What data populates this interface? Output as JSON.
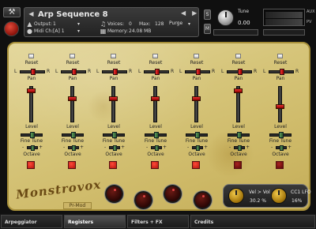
{
  "header": {
    "instrument_name": "Arp Sequence 8",
    "output_label": "Output:",
    "output_value": "1",
    "midi_label": "Midi Ch:",
    "midi_value": "[A] 1",
    "voices_label": "Voices:",
    "voices_value": "0",
    "max_label": "Max:",
    "max_value": "128",
    "purge_label": "Purge",
    "memory_label": "Memory:",
    "memory_value": "24.08 MB",
    "tune_label": "Tune",
    "tune_value": "0.00",
    "s_button": "S",
    "m_button": "M",
    "aux_label": "AUX",
    "pv_label": "PV"
  },
  "channel_labels": {
    "reset": "Reset",
    "pan": "Pan",
    "L": "L",
    "R": "R",
    "level": "Level",
    "fine_tune": "Fine Tune",
    "octave": "Octave",
    "minus": "-",
    "plus": "+"
  },
  "channels": [
    {
      "pan": 0.5,
      "level": 0.05,
      "fine_tune": 0.5,
      "octave": 0,
      "led_on": true
    },
    {
      "pan": 0.5,
      "level": 0.3,
      "fine_tune": 0.5,
      "octave": 0,
      "led_on": true
    },
    {
      "pan": 0.5,
      "level": 0.3,
      "fine_tune": 0.5,
      "octave": 0,
      "led_on": true
    },
    {
      "pan": 0.5,
      "level": 0.3,
      "fine_tune": 0.5,
      "octave": 0,
      "led_on": true
    },
    {
      "pan": 0.5,
      "level": 0.3,
      "fine_tune": 0.5,
      "octave": 0,
      "led_on": true
    },
    {
      "pan": 0.5,
      "level": 0.05,
      "fine_tune": 0.5,
      "octave": 0,
      "led_on": false
    },
    {
      "pan": 0.5,
      "level": 0.55,
      "fine_tune": 0.5,
      "octave": 0,
      "led_on": false
    },
    {
      "pan": 0.5,
      "level": 0.55,
      "fine_tune": 0.5,
      "octave": 0,
      "led_on": false
    }
  ],
  "brand": "Monstrovox",
  "pro_mod_label": "Pr-Mod",
  "cc_panel": {
    "vel_label": "Vel > Vol",
    "vel_value": "30.2 %",
    "cc_label": "CC1 LFO",
    "cc_value": "16%"
  },
  "tabs": [
    "Arpeggiator",
    "Registers",
    "Filters + FX",
    "Credits"
  ],
  "colors": {
    "accent": "#c91f12",
    "parchment": "#d6c57a"
  }
}
